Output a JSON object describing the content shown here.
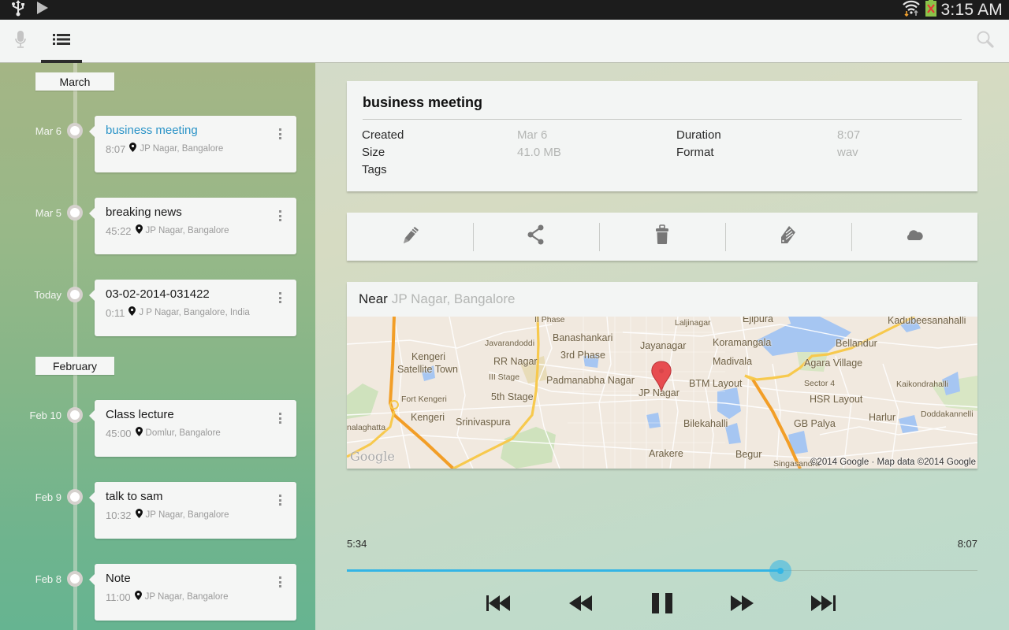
{
  "status_bar": {
    "left_icons": [
      "usb-icon",
      "play-store-icon"
    ],
    "right_icons": [
      "wifi-icon",
      "battery-icon"
    ],
    "time": "3:15 AM"
  },
  "action_bar": {
    "tabs": [
      {
        "name": "record",
        "icon": "mic-icon",
        "active": false
      },
      {
        "name": "list",
        "icon": "list-icon",
        "active": true
      }
    ],
    "search_icon": "search-icon"
  },
  "sidebar": {
    "months": [
      {
        "label": "March",
        "entries": [
          {
            "date": "Mar 6",
            "title": "business meeting",
            "duration": "8:07",
            "location": "JP Nagar, Bangalore",
            "active": true
          },
          {
            "date": "Mar 5",
            "title": "breaking news",
            "duration": "45:22",
            "location": "JP Nagar, Bangalore",
            "active": false
          },
          {
            "date": "Today",
            "title": "03-02-2014-031422",
            "duration": "0:11",
            "location": "J P Nagar, Bangalore, India",
            "active": false
          }
        ]
      },
      {
        "label": "February",
        "entries": [
          {
            "date": "Feb 10",
            "title": "Class lecture",
            "duration": "45:00",
            "location": "Domlur, Bangalore",
            "active": false
          },
          {
            "date": "Feb 9",
            "title": "talk to sam",
            "duration": "10:32",
            "location": "JP Nagar, Bangalore",
            "active": false
          },
          {
            "date": "Feb 8",
            "title": "Note",
            "duration": "11:00",
            "location": "JP Nagar, Bangalore",
            "active": false
          }
        ]
      }
    ]
  },
  "details": {
    "title": "business meeting",
    "fields": {
      "created_label": "Created",
      "created_value": "Mar 6",
      "size_label": "Size",
      "size_value": "41.0 MB",
      "tags_label": "Tags",
      "tags_value": "",
      "duration_label": "Duration",
      "duration_value": "8:07",
      "format_label": "Format",
      "format_value": "wav"
    }
  },
  "actions": [
    "edit-icon",
    "share-icon",
    "delete-icon",
    "tag-icon",
    "cloud-upload-icon"
  ],
  "location": {
    "near_label": "Near",
    "place": "JP Nagar, Bangalore",
    "map": {
      "marker_label": "JP Nagar",
      "labels": [
        "II Phase",
        "Laljinagar",
        "Ejipura",
        "Kadubeesanahalli",
        "Javarandoddi",
        "Banashankari",
        "Jayanagar",
        "Koramangala",
        "Bellandur",
        "Kengeri",
        "Satellite Town",
        "RR Nagar",
        "3rd Phase",
        "Madivala",
        "Agara Village",
        "III Stage",
        "Padmanabha Nagar",
        "JP Nagar",
        "BTM Layout",
        "Sector 4",
        "Kaikondrahalli",
        "Fort Kengeri",
        "5th Stage",
        "HSR Layout",
        "Kengeri",
        "Srinivaspura",
        "Harlur",
        "Doddakannelli",
        "Bilekahalli",
        "GB Palya",
        "nalaghatta",
        "Arakere",
        "Begur",
        "Singasandra"
      ],
      "copyright": "©2014 Google · Map data ©2014 Google",
      "logo": "Google"
    }
  },
  "player": {
    "current_time": "5:34",
    "total_time": "8:07",
    "progress_fraction": 0.687,
    "state": "playing",
    "controls": [
      "skip-previous-icon",
      "rewind-icon",
      "pause-icon",
      "fast-forward-icon",
      "skip-next-icon"
    ]
  },
  "colors": {
    "accent": "#33b5e5",
    "active_title": "#2a93c7"
  }
}
